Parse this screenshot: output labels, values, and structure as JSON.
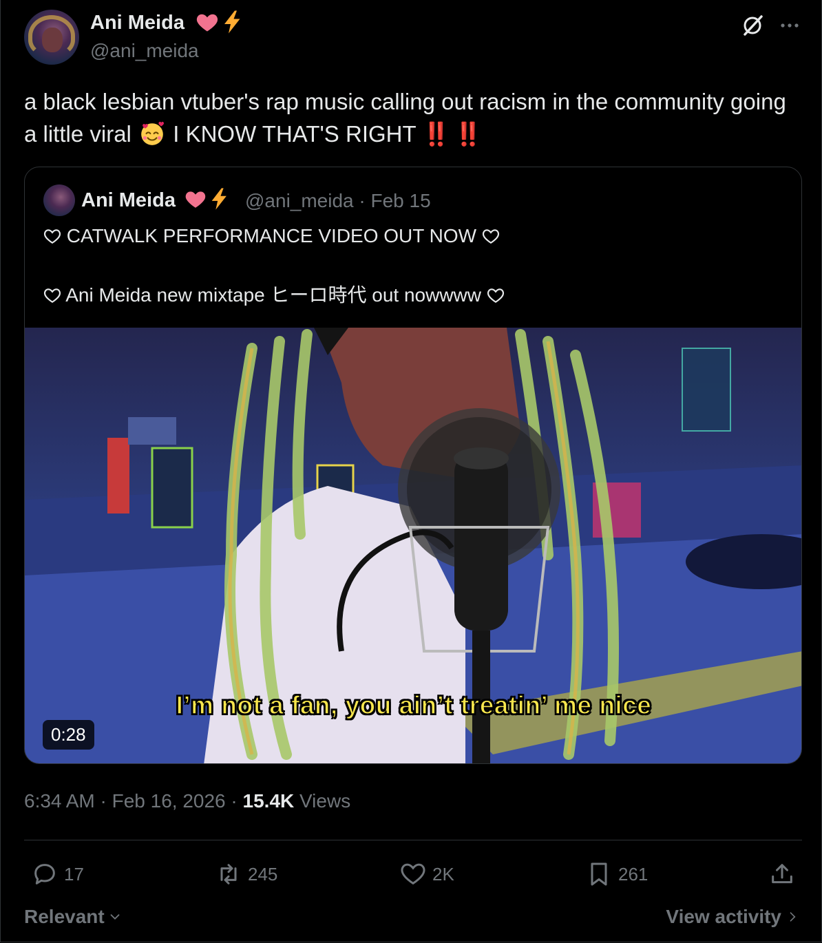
{
  "author": {
    "name": "Ani Meida",
    "handle": "@ani_meida",
    "badges": [
      "pink-heart-icon",
      "lightning-icon"
    ]
  },
  "tweet": {
    "text_part1": "a black lesbian vtuber's rap music calling out racism in the community going a little viral ",
    "text_part2": " I KNOW THAT'S RIGHT ",
    "emphasis": "‼️ ‼️"
  },
  "quote": {
    "name": "Ani Meida",
    "handle_date": "@ani_meida · Feb 15",
    "line1": "CATWALK PERFORMANCE VIDEO OUT NOW",
    "line2": "Ani Meida new mixtape ヒーロ時代 out nowwww",
    "video_caption": "I’m not a fan, you ain’t treatin’ me nice",
    "duration": "0:28"
  },
  "meta": {
    "time": "6:34 AM · Feb 16, 2026 · ",
    "views_count": "15.4K",
    "views_label": " Views"
  },
  "actions": {
    "replies": "17",
    "reposts": "245",
    "likes": "2K",
    "bookmarks": "261"
  },
  "footer": {
    "sort": "Relevant",
    "view_activity": "View activity"
  },
  "colors": {
    "background": "#000000",
    "text": "#e7e9ea",
    "muted": "#71767b",
    "border": "#2f3336",
    "caption": "#f7e64d"
  }
}
